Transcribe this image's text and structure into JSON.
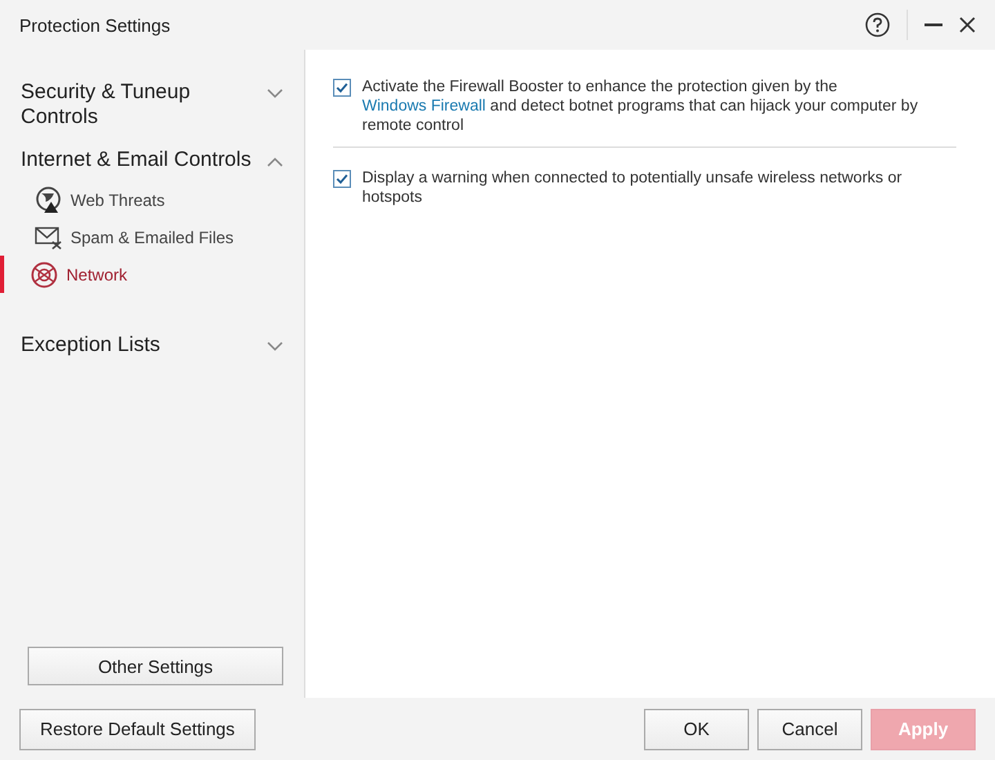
{
  "window": {
    "title": "Protection Settings"
  },
  "sidebar": {
    "sections": [
      {
        "label": "Security & Tuneup Controls",
        "expanded": false
      },
      {
        "label": "Internet & Email Controls",
        "expanded": true,
        "children": [
          {
            "label": "Web Threats",
            "kind": "globe",
            "selected": false
          },
          {
            "label": "Spam & Emailed Files",
            "kind": "mail",
            "selected": false
          },
          {
            "label": "Network",
            "kind": "network",
            "selected": true
          }
        ]
      },
      {
        "label": "Exception Lists",
        "expanded": false
      }
    ],
    "other_settings": "Other Settings"
  },
  "options": [
    {
      "text_before": "Activate the Firewall Booster to enhance the protection given by the",
      "link": "Windows Firewall",
      "text_after": "and detect botnet programs that can hijack your computer by remote control",
      "checked": true
    },
    {
      "text_before": "Display a warning when connected to potentially unsafe wireless networks or hotspots",
      "checked": true
    }
  ],
  "footer": {
    "restore": "Restore Default Settings",
    "buttons": [
      {
        "label": "OK",
        "disabled": false
      },
      {
        "label": "Cancel",
        "disabled": false
      },
      {
        "label": "Apply",
        "disabled": true
      }
    ]
  }
}
